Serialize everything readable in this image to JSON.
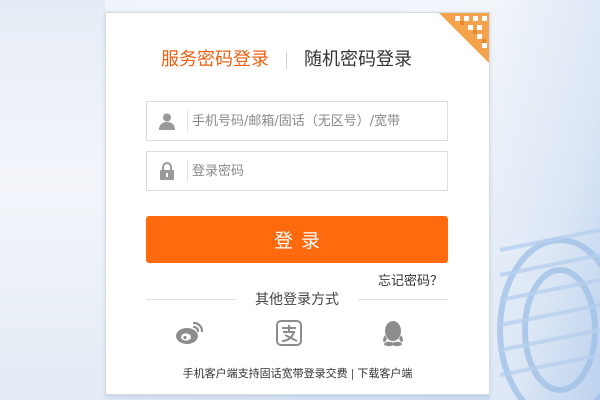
{
  "tabs": {
    "service_password": "服务密码登录",
    "random_password": "随机密码登录"
  },
  "fields": {
    "username_placeholder": "手机号码/邮箱/固话（无区号）/宽带",
    "password_placeholder": "登录密码"
  },
  "login_button": "登录",
  "forgot_password": "忘记密码？",
  "other_login_label": "其他登录方式",
  "social_icons": [
    "weibo-icon",
    "alipay-icon",
    "qq-icon"
  ],
  "footer": {
    "client_promo": "手机客户端支持固话宽带登录交费",
    "separator": "|",
    "download_client": "下载客户端"
  },
  "colors": {
    "accent": "#ff6a0e",
    "active_tab": "#f05f0f",
    "icon_gray": "#8c8c8c"
  }
}
